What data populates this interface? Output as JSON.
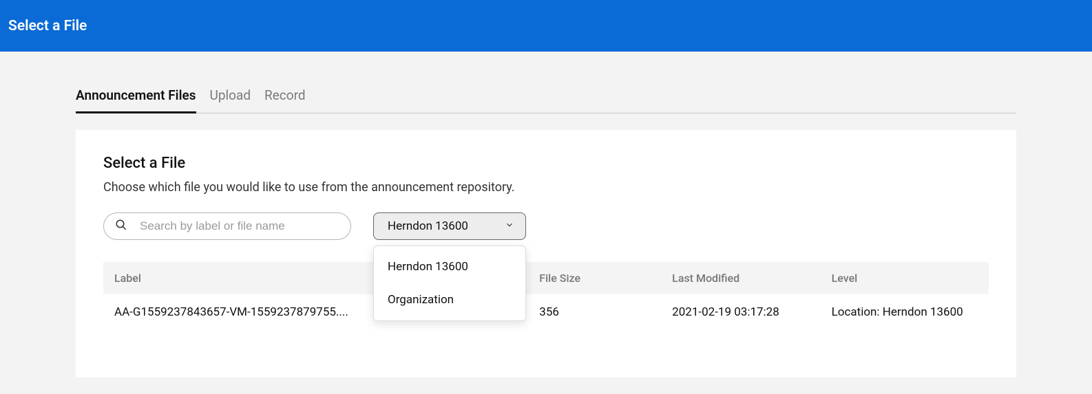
{
  "header": {
    "title": "Select a File"
  },
  "tabs": [
    {
      "label": "Announcement Files",
      "active": true
    },
    {
      "label": "Upload",
      "active": false
    },
    {
      "label": "Record",
      "active": false
    }
  ],
  "panel": {
    "title": "Select a File",
    "description": "Choose which file you would like to use from the announcement repository."
  },
  "search": {
    "placeholder": "Search by label or file name"
  },
  "dropdown": {
    "selected": "Herndon 13600",
    "options": [
      "Herndon 13600",
      "Organization"
    ]
  },
  "table": {
    "headers": {
      "label": "Label",
      "file_size": "File Size",
      "last_modified": "Last Modified",
      "level": "Level"
    },
    "rows": [
      {
        "label": "AA-G1559237843657-VM-1559237879755....",
        "file_size": "356",
        "last_modified": "2021-02-19 03:17:28",
        "level": "Location: Herndon 13600"
      }
    ]
  }
}
